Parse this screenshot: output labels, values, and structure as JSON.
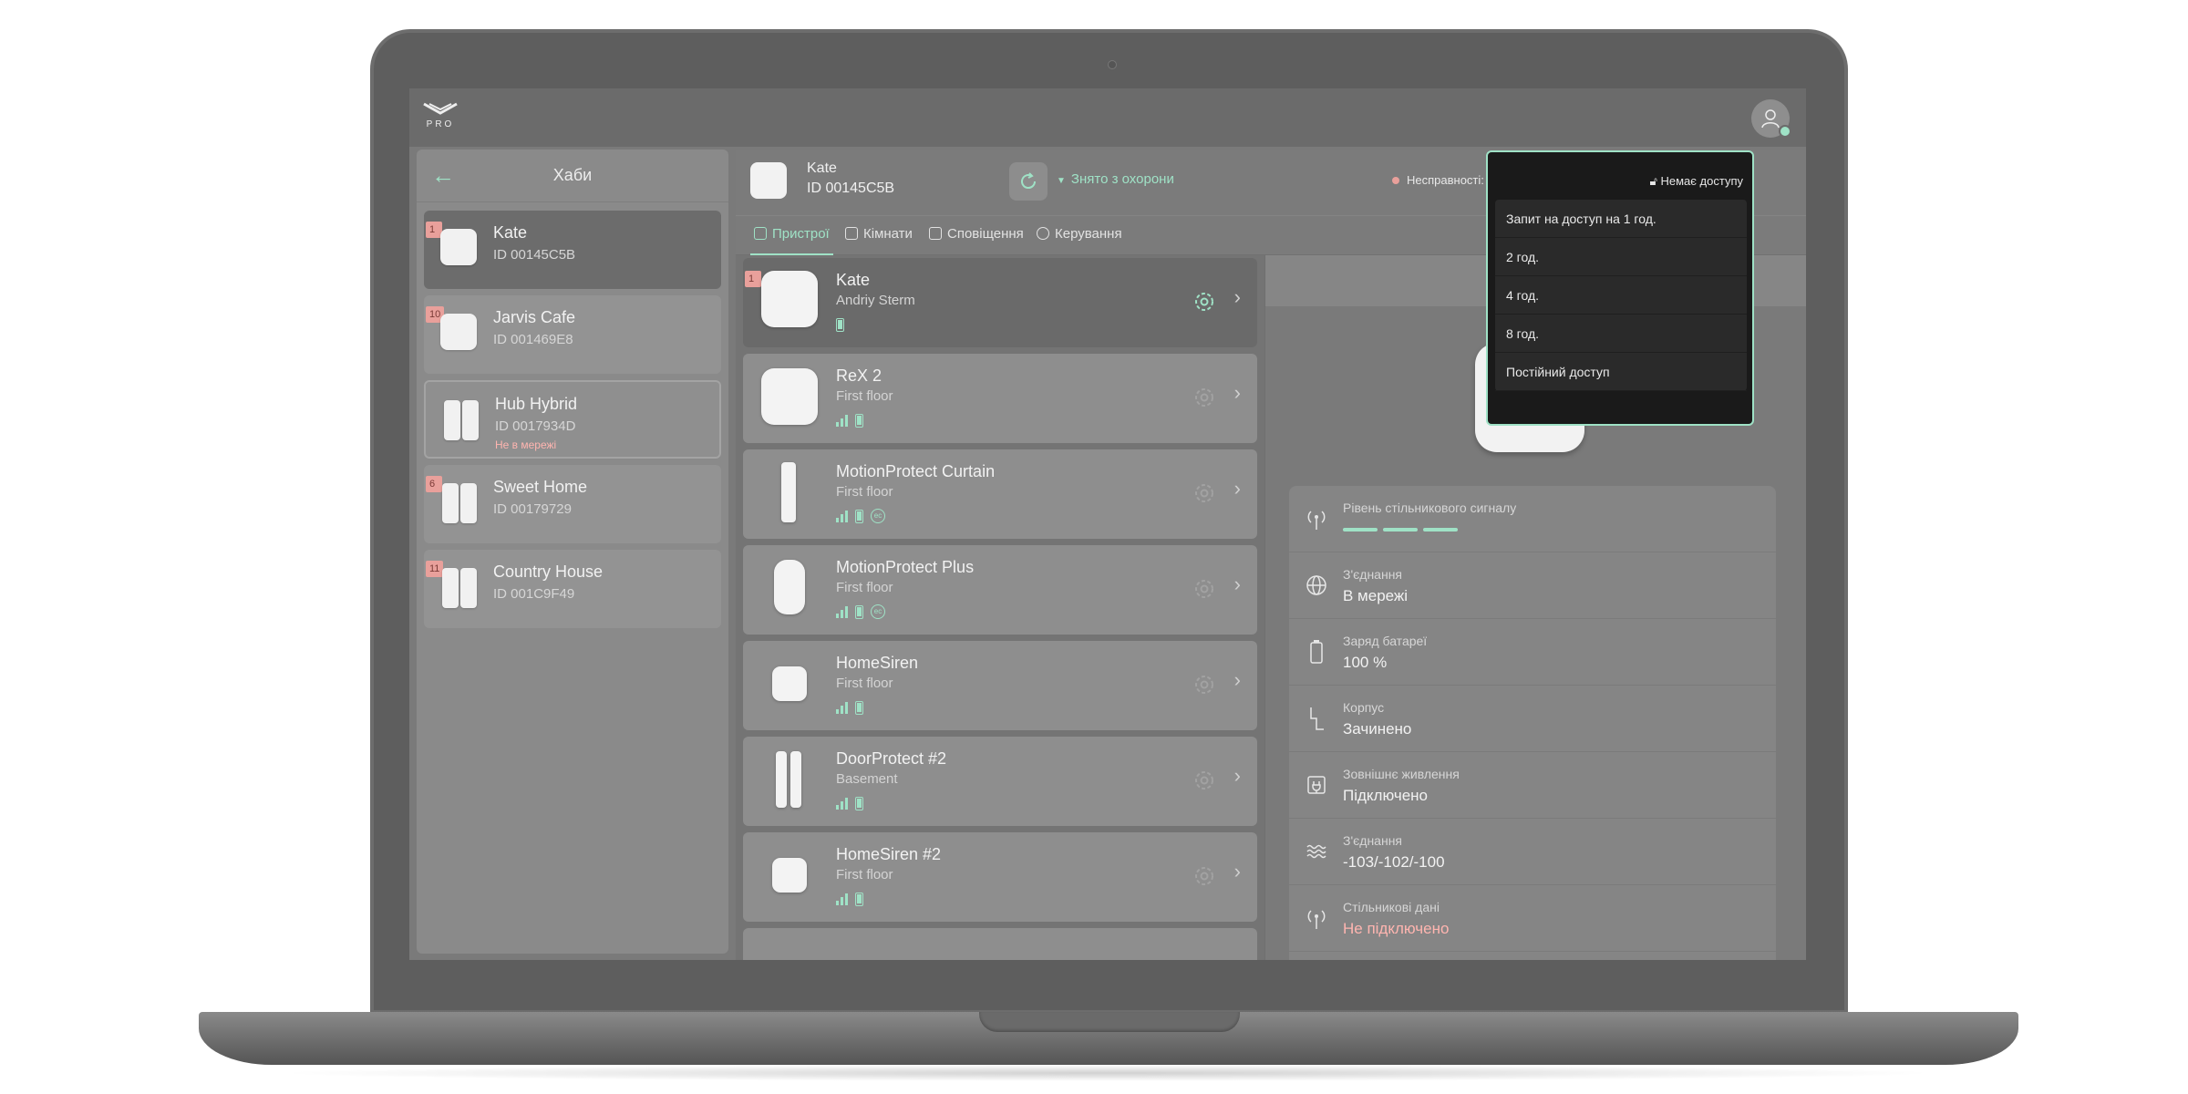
{
  "app": {
    "logo_text": "PRO"
  },
  "hubs": {
    "title": "Хаби",
    "items": [
      {
        "name": "Kate",
        "id": "ID 00145C5B",
        "badge": "1",
        "warning": ""
      },
      {
        "name": "Jarvis Cafe",
        "id": "ID 001469E8",
        "badge": "10",
        "warning": ""
      },
      {
        "name": "Hub Hybrid",
        "id": "ID 0017934D",
        "badge": "",
        "warning": "Не в мережі"
      },
      {
        "name": "Sweet Home",
        "id": "ID 00179729",
        "badge": "6",
        "warning": ""
      },
      {
        "name": "Country House",
        "id": "ID 001C9F49",
        "badge": "11",
        "warning": ""
      }
    ]
  },
  "hub_header": {
    "name": "Kate",
    "id": "ID  00145C5B",
    "arm_status": "Знято з охорони",
    "faults": "Несправності: 1"
  },
  "tabs": [
    "Пристрої",
    "Кімнати",
    "Сповіщення",
    "Керування"
  ],
  "devices": [
    {
      "name": "Kate",
      "sub": "Andriy Sterm",
      "badge": "1"
    },
    {
      "name": "ReX 2",
      "sub": "First floor",
      "badge": ""
    },
    {
      "name": "MotionProtect Curtain",
      "sub": "First floor",
      "badge": ""
    },
    {
      "name": "MotionProtect Plus",
      "sub": "First floor",
      "badge": ""
    },
    {
      "name": "HomeSiren",
      "sub": "First floor",
      "badge": ""
    },
    {
      "name": "DoorProtect #2",
      "sub": "Basement",
      "badge": ""
    },
    {
      "name": "HomeSiren #2",
      "sub": "First floor",
      "badge": ""
    }
  ],
  "eco_label": "ec",
  "details": {
    "props": [
      {
        "label": "Рівень стільникового сигналу",
        "value": ""
      },
      {
        "label": "З'єднання",
        "value": "В мережі"
      },
      {
        "label": "Заряд батареї",
        "value": "100 %"
      },
      {
        "label": "Корпус",
        "value": "Зачинено"
      },
      {
        "label": "Зовнішнє живлення",
        "value": "Підключено"
      },
      {
        "label": "З'єднання",
        "value": "-103/-102/-100"
      },
      {
        "label": "Стільникові дані",
        "value": "Не підключено"
      }
    ]
  },
  "access_menu": {
    "status": "Немає доступу",
    "options": [
      "Запит на доступ на 1 год.",
      "2 год.",
      "4 год.",
      "8 год.",
      "Постійний доступ"
    ]
  },
  "colors": {
    "accent": "#9fe2c6",
    "alert": "#e9a09b"
  }
}
